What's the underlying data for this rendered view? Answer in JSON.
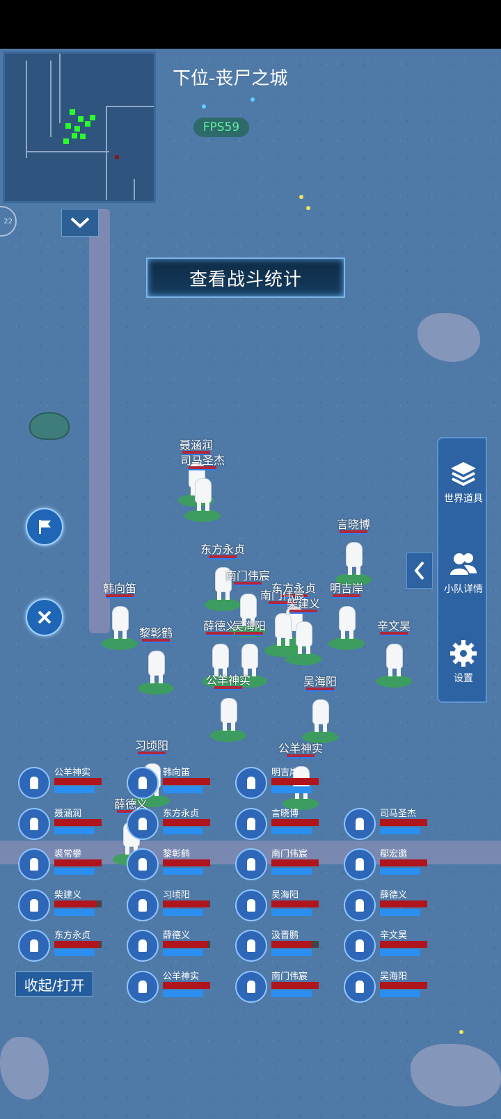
{
  "hud": {
    "map_title": "下位-丧尸之城",
    "fps": "FPS59",
    "battle_stats_button": "查看战斗统计",
    "zoom_label": "22",
    "collapse_toggle": "收起/打开"
  },
  "side_panel": {
    "world_items": "世界道具",
    "squad_details": "小队详情",
    "settings": "设置"
  },
  "field_characters": [
    {
      "name": "聂涵润"
    },
    {
      "name": "司马圣杰"
    },
    {
      "name": "言晓博"
    },
    {
      "name": "东方永贞"
    },
    {
      "name": "南门伟宸"
    },
    {
      "name": "东方永贞"
    },
    {
      "name": "明吉岸"
    },
    {
      "name": "南门伟宸"
    },
    {
      "name": "柴建义"
    },
    {
      "name": "韩向笛"
    },
    {
      "name": "黎彰鹤"
    },
    {
      "name": "薛德义"
    },
    {
      "name": "吴海阳"
    },
    {
      "name": "辛文昊"
    },
    {
      "name": "公羊神实"
    },
    {
      "name": "吴海阳"
    },
    {
      "name": "习顷阳"
    },
    {
      "name": "公羊神实"
    },
    {
      "name": "薛德义"
    }
  ],
  "squad": [
    {
      "name": "公羊神实",
      "hp": 1.0
    },
    {
      "name": "韩向笛",
      "hp": 1.0
    },
    {
      "name": "明吉岸",
      "hp": 1.0
    },
    {
      "name": "聂涵润",
      "hp": 1.0
    },
    {
      "name": "东方永贞",
      "hp": 1.0
    },
    {
      "name": "言晓博",
      "hp": 1.0
    },
    {
      "name": "司马圣杰",
      "hp": 1.0
    },
    {
      "name": "裘常攀",
      "hp": 1.0
    },
    {
      "name": "黎彰鹤",
      "hp": 1.0
    },
    {
      "name": "南门伟宸",
      "hp": 1.0
    },
    {
      "name": "郗宏邈",
      "hp": 1.0
    },
    {
      "name": "柴建义",
      "hp": 0.9
    },
    {
      "name": "习顷阳",
      "hp": 0.97
    },
    {
      "name": "吴海阳",
      "hp": 1.0
    },
    {
      "name": "薛德义",
      "hp": 1.0
    },
    {
      "name": "东方永贞",
      "hp": 0.95
    },
    {
      "name": "薛德义",
      "hp": 0.95
    },
    {
      "name": "汲晋鹏",
      "hp": 0.85
    },
    {
      "name": "辛文昊",
      "hp": 1.0
    },
    {
      "name": "公羊神实",
      "hp": 1.0
    },
    {
      "name": "南门伟宸",
      "hp": 1.0
    },
    {
      "name": "吴海阳",
      "hp": 1.0
    }
  ],
  "colors": {
    "ground": "#4f79a6",
    "panel": "#2d63a3",
    "hp": "#b0151e",
    "mp": "#2a8ff0",
    "fps_text": "#5ef39e"
  }
}
